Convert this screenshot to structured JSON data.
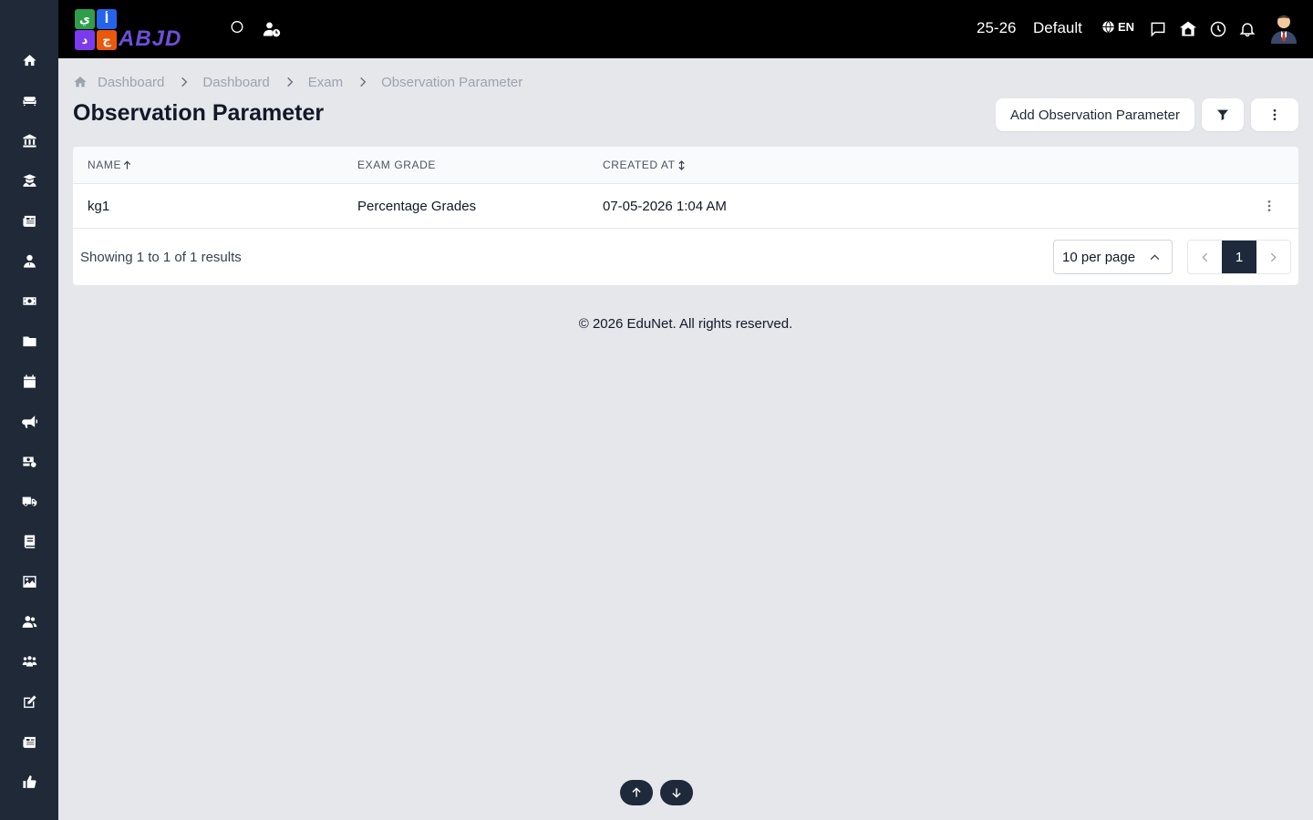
{
  "sidebar": {
    "items": [
      {
        "name": "sidebar-item-home",
        "icon": "home-icon"
      },
      {
        "name": "sidebar-item-classroom",
        "icon": "sofa-icon"
      },
      {
        "name": "sidebar-item-institution",
        "icon": "bank-icon"
      },
      {
        "name": "sidebar-item-graduation",
        "icon": "graduate-icon"
      },
      {
        "name": "sidebar-item-news",
        "icon": "newspaper-icon"
      },
      {
        "name": "sidebar-item-teacher",
        "icon": "user-tie-icon"
      },
      {
        "name": "sidebar-item-fees",
        "icon": "money-icon"
      },
      {
        "name": "sidebar-item-files",
        "icon": "folder-icon"
      },
      {
        "name": "sidebar-item-calendar",
        "icon": "calendar-icon"
      },
      {
        "name": "sidebar-item-announcements",
        "icon": "megaphone-icon"
      },
      {
        "name": "sidebar-item-transactions",
        "icon": "money-gear-icon"
      },
      {
        "name": "sidebar-item-transport",
        "icon": "truck-icon"
      },
      {
        "name": "sidebar-item-library",
        "icon": "book-icon"
      },
      {
        "name": "sidebar-item-gallery",
        "icon": "image-icon"
      },
      {
        "name": "sidebar-item-users",
        "icon": "users-icon"
      },
      {
        "name": "sidebar-item-groups",
        "icon": "people-group-icon"
      },
      {
        "name": "sidebar-item-exam",
        "icon": "edit-icon"
      },
      {
        "name": "sidebar-item-reports",
        "icon": "report-icon"
      },
      {
        "name": "sidebar-item-feedback",
        "icon": "thumbs-up-icon"
      }
    ]
  },
  "header": {
    "logo_text": "ABJD",
    "logo_tiles": [
      "ي",
      "أ",
      "د",
      "ج"
    ],
    "session": "25-26",
    "theme": "Default",
    "language": "EN",
    "icons": [
      "circle-icon",
      "user-clock-icon",
      "globe-icon",
      "message-icon",
      "school-icon",
      "clock-icon",
      "bell-icon",
      "avatar"
    ]
  },
  "breadcrumb": [
    "Dashboard",
    "Dashboard",
    "Exam",
    "Observation Parameter"
  ],
  "page": {
    "title": "Observation Parameter",
    "add_button": "Add Observation Parameter"
  },
  "table": {
    "columns": [
      "NAME",
      "EXAM GRADE",
      "CREATED AT"
    ],
    "rows": [
      {
        "name": "kg1",
        "exam_grade": "Percentage Grades",
        "created_at": "07-05-2026 1:04 AM"
      }
    ]
  },
  "pagination": {
    "summary": "Showing 1 to 1 of 1 results",
    "per_page": "10 per page",
    "current_page": "1"
  },
  "footer": {
    "text": "© 2026 EduNet. All rights reserved."
  },
  "colors": {
    "sidebar": "#1f2937",
    "topbar": "#000000",
    "background": "#e5e7eb",
    "active_page": "#1e293b"
  }
}
